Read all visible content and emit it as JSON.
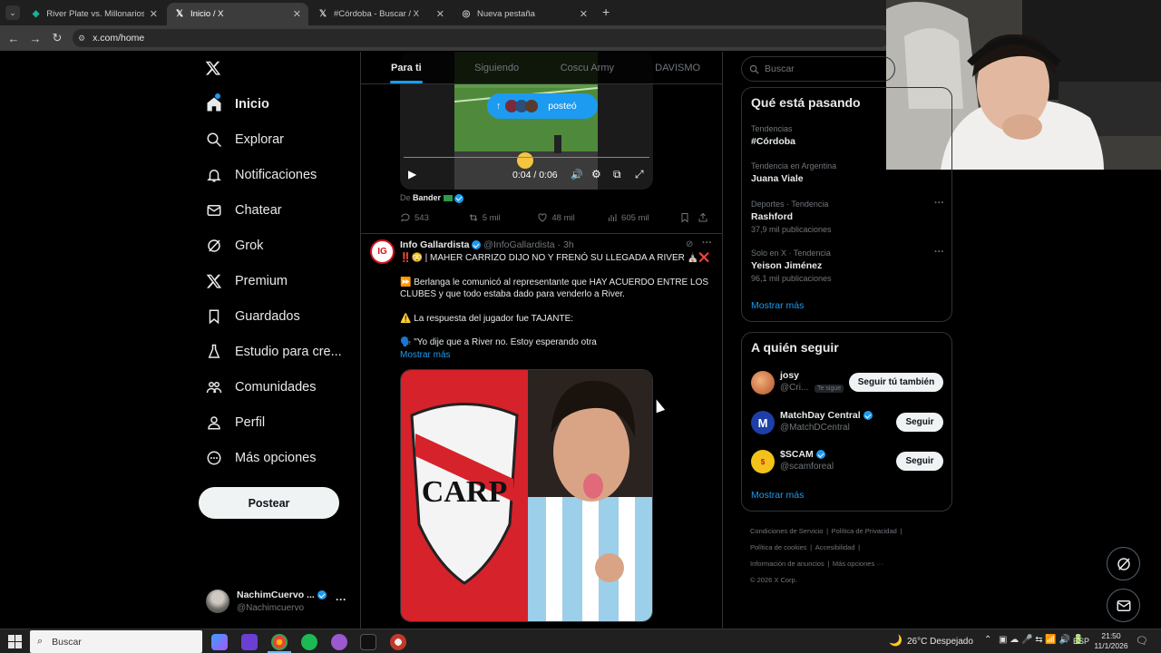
{
  "browser": {
    "tabs": [
      {
        "title": "River Plate vs. Millonarios | Disn",
        "active": false
      },
      {
        "title": "Inicio / X",
        "active": true
      },
      {
        "title": "#Córdoba - Buscar / X",
        "active": false
      },
      {
        "title": "Nueva pestaña",
        "active": false
      }
    ],
    "url": "x.com/home"
  },
  "sidebar": {
    "logo": "X",
    "items": [
      {
        "label": "Inicio",
        "icon": "home-icon"
      },
      {
        "label": "Explorar",
        "icon": "search-icon"
      },
      {
        "label": "Notificaciones",
        "icon": "bell-icon"
      },
      {
        "label": "Chatear",
        "icon": "mail-icon"
      },
      {
        "label": "Grok",
        "icon": "grok-icon"
      },
      {
        "label": "Premium",
        "icon": "x-logo-icon"
      },
      {
        "label": "Guardados",
        "icon": "bookmark-icon"
      },
      {
        "label": "Estudio para cre...",
        "icon": "flask-icon"
      },
      {
        "label": "Comunidades",
        "icon": "people-icon"
      },
      {
        "label": "Perfil",
        "icon": "person-icon"
      },
      {
        "label": "Más opciones",
        "icon": "more-circle-icon"
      }
    ],
    "post_button": "Postear",
    "account": {
      "name": "NachimCuervo ...",
      "handle": "@Nachimcuervo"
    }
  },
  "timeline": {
    "tabs": [
      "Para ti",
      "Siguiendo",
      "Coscu Army",
      "DAVISMO"
    ],
    "video_tweet": {
      "posted_pill": "posteó",
      "time": "0:04 / 0:06",
      "from_prefix": "De",
      "from_name": "Bander",
      "replies": "543",
      "reposts": "5 mil",
      "likes": "48 mil",
      "views": "605 mil"
    },
    "tweet": {
      "name": "Info Gallardista",
      "handle": "@InfoGallardista",
      "time": "· 3h",
      "avatar_text": "IG",
      "line1": "‼️😳 | MAHER CARRIZO DIJO NO Y FRENÓ SU LLEGADA A RIVER ⛪❌",
      "line2": "⏩ Berlanga le comunicó al representante que HAY ACUERDO ENTRE LOS CLUBES y que todo estaba dado para venderlo a River.",
      "line3": "⚠️ La respuesta del jugador fue TAJANTE:",
      "line4": "🗣️ \"Yo dije que a River no. Estoy esperando otra",
      "show_more": "Mostrar más",
      "crest_text": "CARP"
    }
  },
  "right": {
    "search_placeholder": "Buscar",
    "trends_title": "Qué está pasando",
    "trends": [
      {
        "context": "Tendencias",
        "name": "#Córdoba",
        "count": ""
      },
      {
        "context": "Tendencia en Argentina",
        "name": "Juana Viale",
        "count": ""
      },
      {
        "context": "Deportes · Tendencia",
        "name": "Rashford",
        "count": "37,9 mil publicaciones"
      },
      {
        "context": "Solo en X · Tendencia",
        "name": "Yeison Jiménez",
        "count": "96,1 mil publicaciones"
      }
    ],
    "trends_more": "Mostrar más",
    "follow_title": "A quién seguir",
    "follow": [
      {
        "name": "josy",
        "handle": "@Cri...",
        "badge": "Te sigue",
        "button": "Seguir tú también",
        "verified": false
      },
      {
        "name": "MatchDay Central",
        "handle": "@MatchDCentral",
        "badge": "",
        "button": "Seguir",
        "verified": true
      },
      {
        "name": "$SCAM",
        "handle": "@scamforeal",
        "badge": "",
        "button": "Seguir",
        "verified": true
      }
    ],
    "follow_more": "Mostrar más",
    "footer": [
      "Condiciones de Servicio",
      "|",
      "Política de Privacidad",
      "|",
      "Política de cookies",
      "|",
      "Accesibilidad",
      "|",
      "Información de anuncios",
      "|",
      "Más opciones ···",
      "© 2026 X Corp."
    ]
  },
  "taskbar": {
    "search": "Buscar",
    "weather": "26°C  Despejado",
    "lang": "ESP",
    "time": "21:50",
    "date": "11/1/2026"
  },
  "colors": {
    "accent": "#1d9bf0",
    "bg": "#000000",
    "border": "#2f3336",
    "muted": "#71767b"
  }
}
